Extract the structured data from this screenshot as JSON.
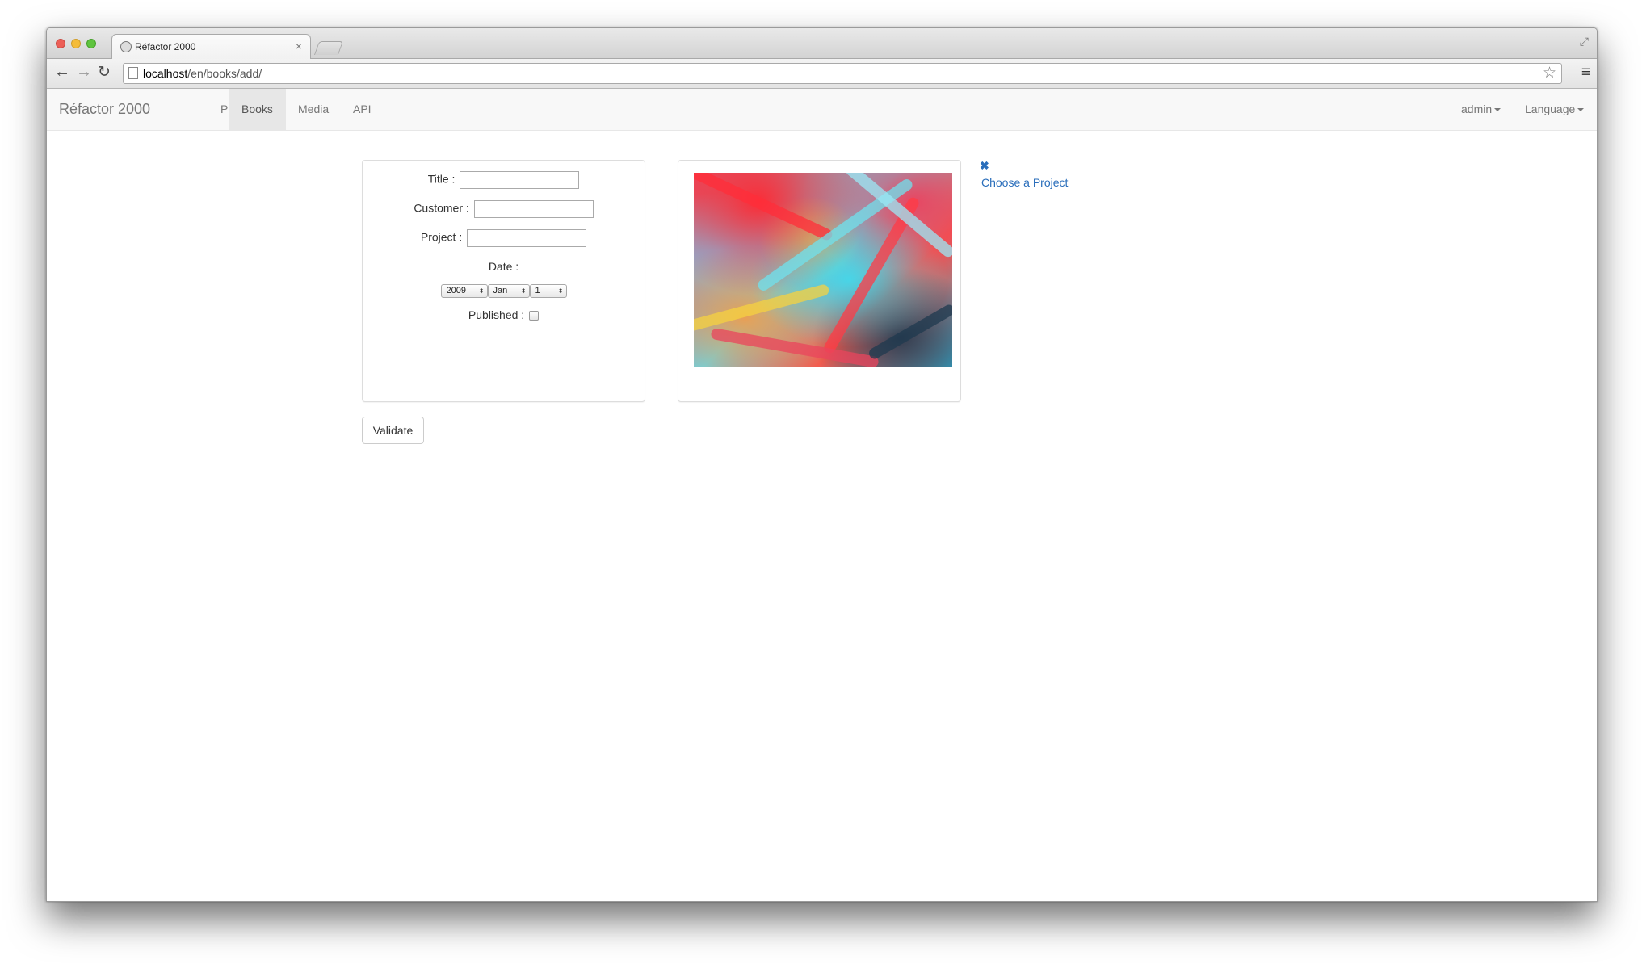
{
  "browser": {
    "tab_title": "Réfactor 2000",
    "tab_close": "×",
    "url_host": "localhost",
    "url_path": "/en/books/add/"
  },
  "navbar": {
    "brand": "Réfactor 2000",
    "items": [
      {
        "label": "Projects",
        "active": false
      },
      {
        "label": "Books",
        "active": true
      },
      {
        "label": "Media",
        "active": false
      },
      {
        "label": "API",
        "active": false
      }
    ],
    "right_items": [
      {
        "label": "admin"
      },
      {
        "label": "Language"
      }
    ]
  },
  "form": {
    "title_label": "Title :",
    "title_value": "",
    "customer_label": "Customer :",
    "customer_value": "",
    "project_label": "Project :",
    "project_value": "",
    "date_label": "Date :",
    "date_year": "2009",
    "date_month": "Jan",
    "date_day": "1",
    "published_label": "Published :",
    "published_checked": false,
    "validate_label": "Validate"
  },
  "sidebar": {
    "remove_icon": "✖",
    "choose_project_label": "Choose a Project"
  },
  "icons": {
    "back": "←",
    "forward": "→",
    "reload": "↻",
    "star": "☆",
    "menu": "≡",
    "fullscreen": "⤢",
    "select_arrows": "⬍"
  }
}
